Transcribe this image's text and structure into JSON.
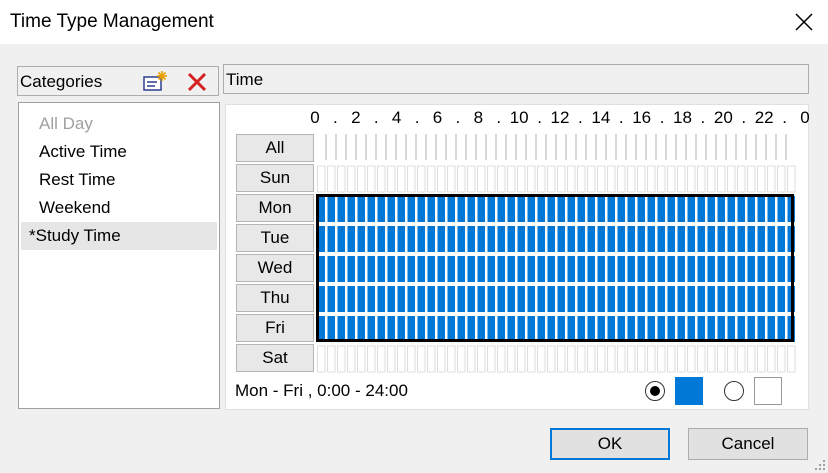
{
  "window": {
    "title": "Time Type Management",
    "close_icon": "close-icon"
  },
  "categories": {
    "header": "Categories",
    "add_icon": "new-category-icon",
    "delete_icon": "delete-icon",
    "items": [
      {
        "label": "All Day",
        "state": "disabled"
      },
      {
        "label": "Active Time",
        "state": "normal"
      },
      {
        "label": "Rest Time",
        "state": "normal"
      },
      {
        "label": "Weekend",
        "state": "normal"
      },
      {
        "label": "*Study Time",
        "state": "selected"
      }
    ]
  },
  "time": {
    "header": "Time",
    "axis_labels": [
      "0",
      ".",
      "2",
      ".",
      "4",
      ".",
      "6",
      ".",
      "8",
      ".",
      "10",
      ".",
      "12",
      ".",
      "14",
      ".",
      "16",
      ".",
      "18",
      ".",
      "20",
      ".",
      "22",
      ".",
      "0"
    ],
    "days": [
      "All",
      "Sun",
      "Mon",
      "Tue",
      "Wed",
      "Thu",
      "Fri",
      "Sat"
    ],
    "slots_per_day": 48,
    "selected_rows": [
      "Mon",
      "Tue",
      "Wed",
      "Thu",
      "Fri"
    ],
    "selected_color": "#0078d7",
    "summary": "Mon - Fri , 0:00 - 24:00"
  },
  "mode": {
    "fill_selected": true,
    "fill_color": "#0078d7",
    "clear_color": "#ffffff"
  },
  "buttons": {
    "ok": "OK",
    "cancel": "Cancel"
  }
}
